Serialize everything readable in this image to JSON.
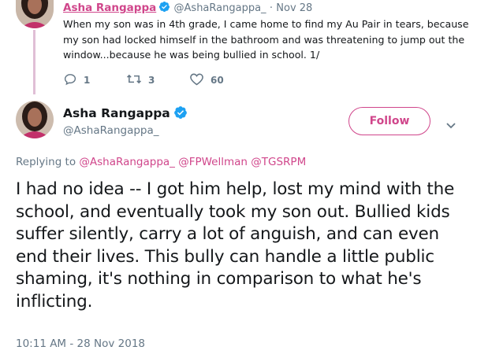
{
  "parent_tweet": {
    "name": "Asha Rangappa",
    "handle": "@AshaRangappa_",
    "separator": "·",
    "date": "Nov 28",
    "text": "When my son was in 4th grade, I came home to find my Au Pair in tears, because my son had locked himself in the bathroom and was threatening to jump out the window...because he was being bullied in school. 1/",
    "actions": {
      "reply_count": "1",
      "retweet_count": "3",
      "like_count": "60"
    }
  },
  "main_tweet": {
    "name": "Asha Rangappa",
    "handle": "@AshaRangappa_",
    "follow_label": "Follow",
    "replying_to_label": "Replying to",
    "mentions": [
      "@AshaRangappa_",
      "@FPWellman",
      "@TGSRPM"
    ],
    "text": "I had no idea -- I got him help, lost my mind with the school, and eventually took my son out. Bullied kids suffer silently, carry a lot of anguish, and can even end their lives. This bully can handle a little public shaming, it's nothing in comparison to what he's inflicting.",
    "timestamp": "10:11 AM - 28 Nov 2018"
  },
  "icons": {
    "verified": "verified-badge-icon",
    "reply": "reply-icon",
    "retweet": "retweet-icon",
    "like": "heart-icon",
    "caret": "chevron-down-icon"
  },
  "colors": {
    "accent": "#d0468b",
    "verified": "#1da1f2",
    "muted": "#657786",
    "text": "#14171a",
    "thread_line": "#e0bfd6"
  }
}
